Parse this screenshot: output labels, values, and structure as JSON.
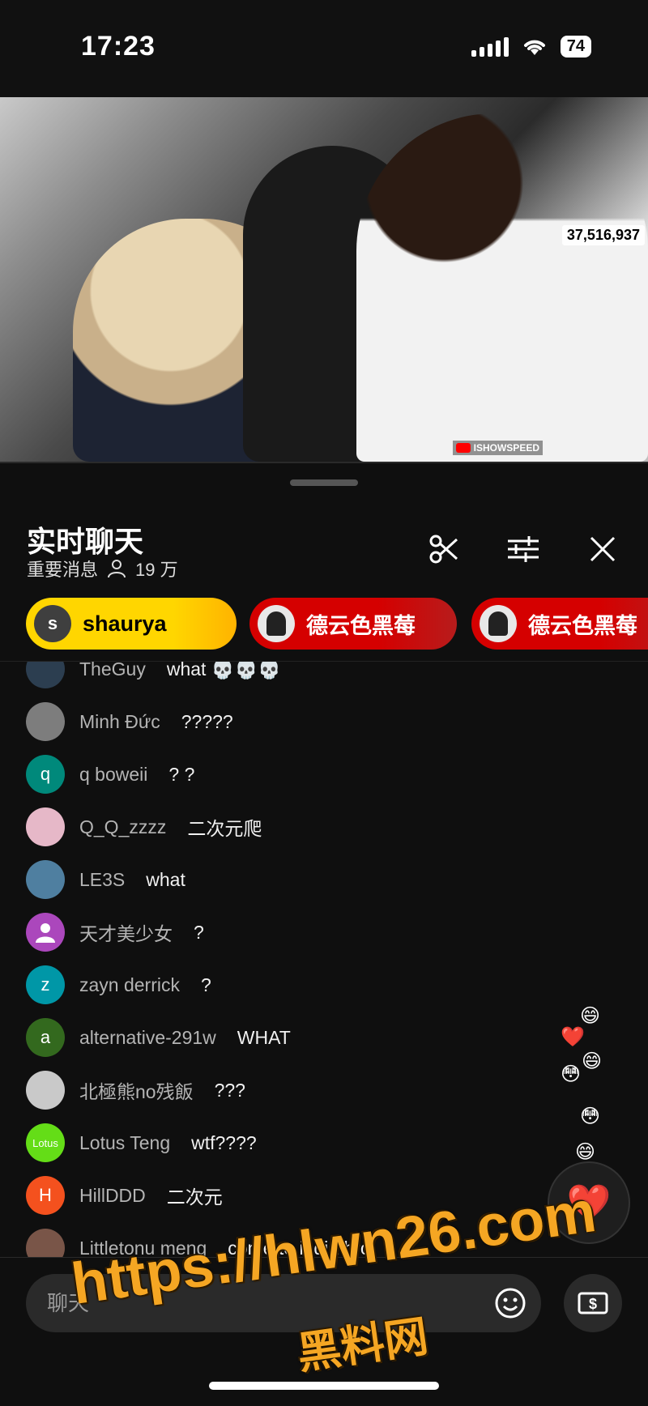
{
  "status_bar": {
    "time": "17:23",
    "battery": "74"
  },
  "video": {
    "viewer_count": "37,516,937",
    "channel_tag": "ISHOWSPEED"
  },
  "chat": {
    "title": "实时聊天",
    "filter_label": "重要消息",
    "viewer_count": "19 万",
    "icons": {
      "clip": "scissors-icon",
      "settings": "sliders-icon",
      "close": "close-icon"
    }
  },
  "superchats": [
    {
      "avatar_letter": "s",
      "name": "shaurya",
      "color": "#ffd600"
    },
    {
      "name": "德云色黑莓",
      "color": "#d50000"
    },
    {
      "name": "德云色黑莓",
      "color": "#d50000"
    }
  ],
  "messages": [
    {
      "author": "TheGuy",
      "text": "what 💀💀💀",
      "avatar_color": "#2c3e50",
      "avatar_letter": ""
    },
    {
      "author": "Minh Đức",
      "text": "?????",
      "avatar_color": "#7d7d7d",
      "avatar_letter": ""
    },
    {
      "author": "q boweii",
      "text": "? ?",
      "avatar_color": "#00897b",
      "avatar_letter": "q"
    },
    {
      "author": "Q_Q_zzzz",
      "text": "二次元爬",
      "avatar_color": "#e6b8c8",
      "avatar_letter": ""
    },
    {
      "author": "LE3S",
      "text": "what",
      "avatar_color": "#4f7fa0",
      "avatar_letter": ""
    },
    {
      "author": "天才美少女",
      "text": "?",
      "avatar_color": "#ab47bc",
      "avatar_letter": ""
    },
    {
      "author": "zayn derrick",
      "text": "?",
      "avatar_color": "#0097a7",
      "avatar_letter": "z"
    },
    {
      "author": "alternative-291w",
      "text": "WHAT",
      "avatar_color": "#33691e",
      "avatar_letter": "a"
    },
    {
      "author": "北極熊no残飯",
      "text": "???",
      "avatar_color": "#c9c9c9",
      "avatar_letter": ""
    },
    {
      "author": "Lotus Teng",
      "text": "wtf????",
      "avatar_color": "#64dd17",
      "avatar_letter": "Lotus"
    },
    {
      "author": "HillDDD",
      "text": "二次元",
      "avatar_color": "#f4511e",
      "avatar_letter": "H"
    },
    {
      "author": "Littletonu meng",
      "text": "come to india bro",
      "avatar_color": "#795548",
      "avatar_letter": ""
    }
  ],
  "input": {
    "placeholder": "聊天"
  },
  "reactions": [
    "😄",
    "❤️",
    "😄",
    "😳",
    "😳",
    "😄"
  ],
  "heart_button": "❤️",
  "watermark": {
    "url": "https://hlwn26.com",
    "name": "黑料网"
  }
}
